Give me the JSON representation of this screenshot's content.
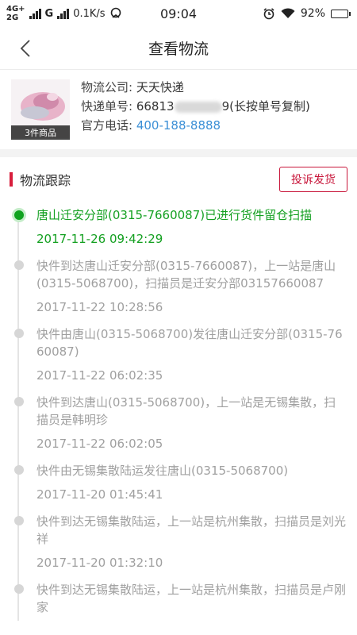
{
  "status_bar": {
    "network_top": "4G+",
    "network_bottom": "2G",
    "carrier2": "G",
    "speed": "0.1K/s",
    "time": "09:04",
    "battery": "92%",
    "battery_level": 0.92
  },
  "header": {
    "title": "查看物流"
  },
  "product": {
    "badge": "3件商品",
    "company_label": "物流公司:",
    "company_value": "天天快递",
    "tracking_label": "快递单号:",
    "tracking_prefix": "66813",
    "tracking_suffix": "9",
    "tracking_hint": "(长按单号复制)",
    "phone_label": "官方电话:",
    "phone_value": "400-188-8888"
  },
  "tracking": {
    "title": "物流跟踪",
    "complain_label": "投诉发货",
    "events": [
      {
        "desc": "唐山迁安分部(0315-7660087)已进行货件留仓扫描",
        "time": "2017-11-26 09:42:29"
      },
      {
        "desc": "快件到达唐山迁安分部(0315-7660087)，上一站是唐山(0315-5068700)，扫描员是迁安分部03157660087",
        "time": "2017-11-22 10:28:56"
      },
      {
        "desc": "快件由唐山(0315-5068700)发往唐山迁安分部(0315-7660087)",
        "time": "2017-11-22 06:02:35"
      },
      {
        "desc": "快件到达唐山(0315-5068700)，上一站是无锡集散，扫描员是韩明珍",
        "time": "2017-11-22 06:02:05"
      },
      {
        "desc": "快件由无锡集散陆运发往唐山(0315-5068700)",
        "time": "2017-11-20 01:45:41"
      },
      {
        "desc": "快件到达无锡集散陆运，上一站是杭州集散，扫描员是刘光祥",
        "time": "2017-11-20 01:32:10"
      },
      {
        "desc": "快件到达无锡集散陆运，上一站是杭州集散，扫描员是卢刚家",
        "time": ""
      }
    ]
  },
  "colors": {
    "accent_red": "#d81e3c",
    "active_green": "#14a021",
    "link_blue": "#3b8fd6"
  }
}
